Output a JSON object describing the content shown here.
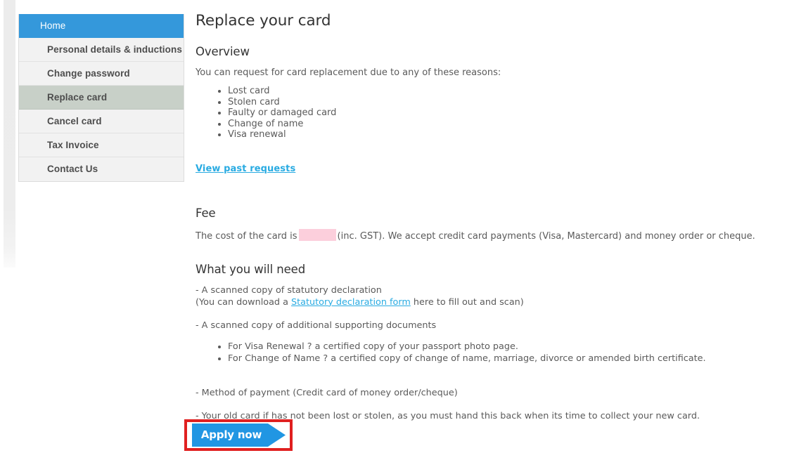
{
  "colors": {
    "accent_blue": "#3498db",
    "active_nav": "#c8d0c8",
    "link_cyan": "#29abe2",
    "button_blue": "#2196e3",
    "annotation_red": "#e02020",
    "redaction_pink": "#fccfdc"
  },
  "sidebar": {
    "items": [
      {
        "label": "Home",
        "state": "home"
      },
      {
        "label": "Personal details & inductions",
        "state": "normal"
      },
      {
        "label": "Change password",
        "state": "normal"
      },
      {
        "label": "Replace card",
        "state": "active"
      },
      {
        "label": "Cancel card",
        "state": "normal"
      },
      {
        "label": "Tax Invoice",
        "state": "normal"
      },
      {
        "label": "Contact Us",
        "state": "normal"
      }
    ]
  },
  "main": {
    "page_title": "Replace your card",
    "overview": {
      "title": "Overview",
      "intro": "You can request for card replacement due to any of these reasons:",
      "reasons": [
        "Lost card",
        "Stolen card",
        "Faulty or damaged card",
        "Change of name",
        "Visa renewal"
      ],
      "past_requests_link": "View past requests"
    },
    "fee": {
      "title": "Fee",
      "text_before": "The cost of the card is",
      "redacted_value": "",
      "text_after": "(inc. GST). We accept credit card payments (Visa, Mastercard) and money order or cheque."
    },
    "what_you_need": {
      "title": "What you will need",
      "line1": "- A scanned copy of statutory declaration",
      "line2_before": "(You can download a ",
      "line2_link": "Statutory declaration form",
      "line2_after": " here to fill out and scan)",
      "line3": " - A scanned copy of additional supporting documents",
      "documents": [
        "For Visa Renewal ? a certified copy of your passport photo page.",
        "For Change of Name ? a certified copy of change of name, marriage, divorce or amended birth certificate."
      ],
      "line4": "- Method of payment (Credit card of money order/cheque)",
      "line5": "- Your old card if has not been lost or stolen, as you must hand this back when its time to collect your new card."
    },
    "apply_button": {
      "label": "Apply now"
    }
  }
}
